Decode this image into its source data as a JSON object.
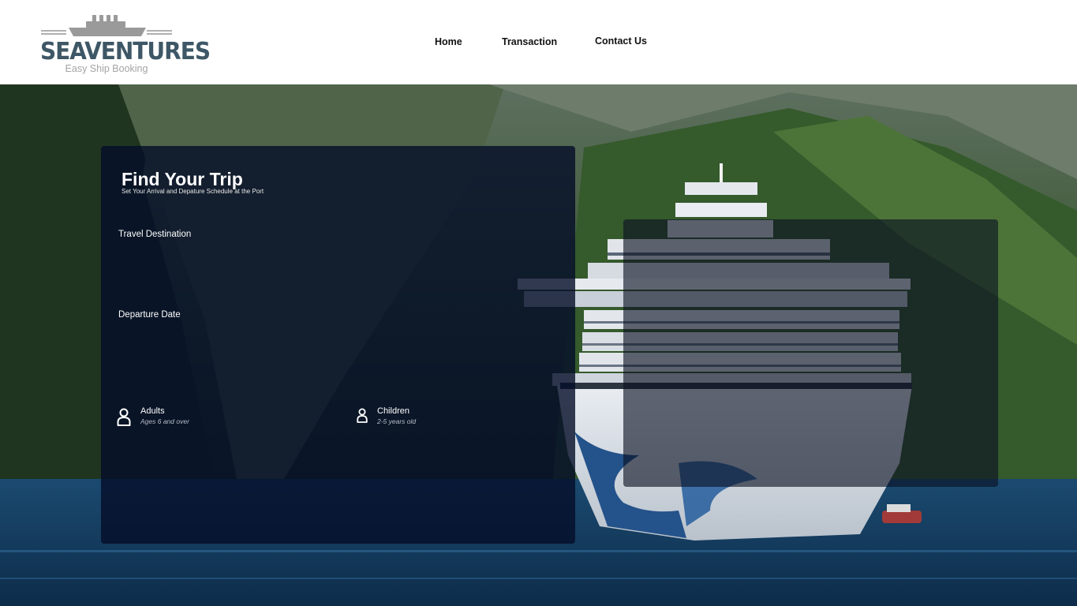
{
  "brand": {
    "name": "SEAVENTURES",
    "tagline": "Easy Ship Booking"
  },
  "nav": {
    "home": "Home",
    "transaction": "Transaction",
    "contact": "Contact Us"
  },
  "search": {
    "title": "Find Your Trip",
    "subtitle": "Set Your Arrival and Depature Schedule at the Port",
    "destination_label": "Travel Destination",
    "departure_label": "Departure Date",
    "adults": {
      "label": "Adults",
      "note": "Ages 6 and over"
    },
    "children": {
      "label": "Children",
      "note": "2-5 years old"
    }
  },
  "colors": {
    "logo_text": "#3e5766",
    "logo_tagline": "#a4a4a4",
    "panel_bg": "#040c28"
  },
  "icons": {
    "logo": "cruise-ship-icon",
    "adults": "person-icon",
    "children": "person-icon"
  }
}
